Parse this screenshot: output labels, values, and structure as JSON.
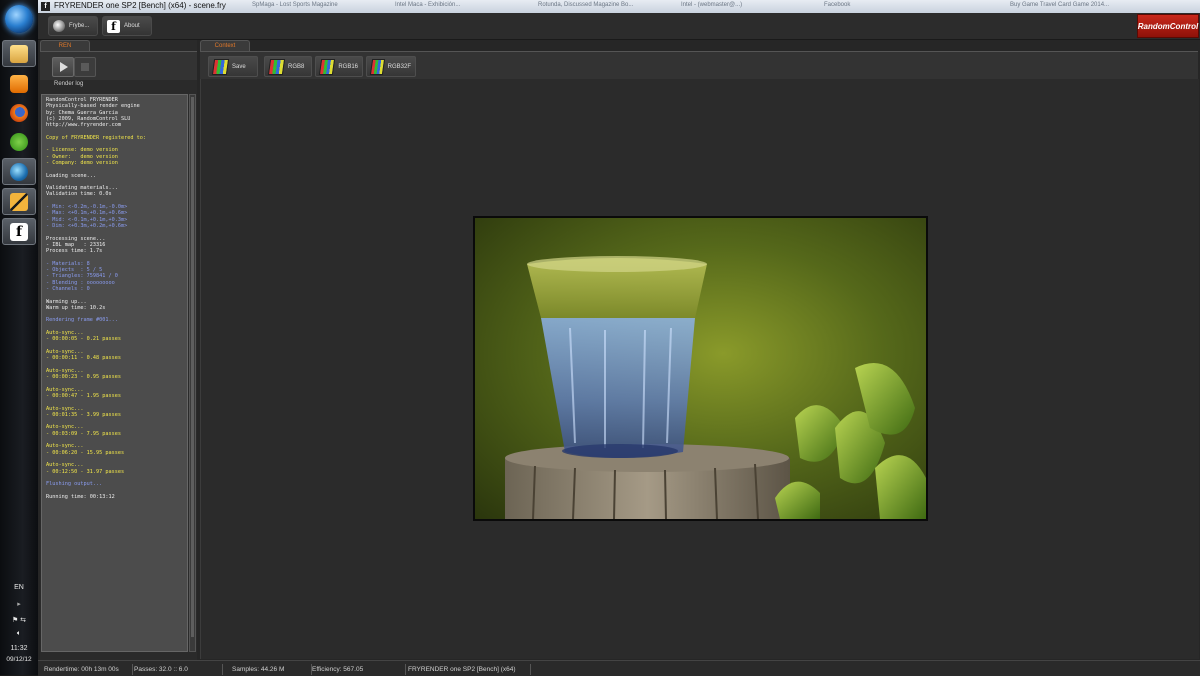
{
  "taskbar": {
    "language": "EN",
    "time": "11:32",
    "date": "09/12/12"
  },
  "window": {
    "title": "FRYRENDER one SP2 [Bench] (x64) - scene.fry",
    "background_tabs": [
      "SpMaga - Lost Sports Magazine",
      "Intel Maca - Exhibición...",
      "Rotunda, Discussed Magazine Bo...",
      "Intel - (webmaster@...)",
      "Facebook",
      "Buy Game Travel Card Game 2014..."
    ]
  },
  "toolbar": {
    "fry_label": "Frybe...",
    "about_label": "About",
    "brand": "RandomControl"
  },
  "ren_panel": {
    "tab": "REN",
    "log_label": "Render log",
    "log": [
      {
        "t": "RandomControl FRYRENDER",
        "c": "white"
      },
      {
        "t": "Physically-based render engine",
        "c": "white"
      },
      {
        "t": "by: Chema Guerra Garcia",
        "c": "white"
      },
      {
        "t": "(c) 2009, RandomControl SLU",
        "c": "white"
      },
      {
        "t": "http://www.fryrender.com",
        "c": "white"
      },
      {
        "t": "",
        "c": "white"
      },
      {
        "t": "Copy of FRYRENDER registered to:",
        "c": "yellow"
      },
      {
        "t": "",
        "c": "white"
      },
      {
        "t": "- License: demo version",
        "c": "yellow"
      },
      {
        "t": "- Owner:   demo version",
        "c": "yellow"
      },
      {
        "t": "- Company: demo version",
        "c": "yellow"
      },
      {
        "t": "",
        "c": "white"
      },
      {
        "t": "Loading scene...",
        "c": "white"
      },
      {
        "t": "",
        "c": "white"
      },
      {
        "t": "Validating materials...",
        "c": "white"
      },
      {
        "t": "Validation time: 0.0s",
        "c": "white"
      },
      {
        "t": "",
        "c": "white"
      },
      {
        "t": "- Min: <-0.2m,-0.1m,-0.0m>",
        "c": "blue"
      },
      {
        "t": "- Max: <+0.1m,+0.1m,+0.6m>",
        "c": "blue"
      },
      {
        "t": "- Mid: <-0.1m,+0.1m,+0.3m>",
        "c": "blue"
      },
      {
        "t": "- Dim: <+0.3m,+0.2m,+0.6m>",
        "c": "blue"
      },
      {
        "t": "",
        "c": "white"
      },
      {
        "t": "Processing scene...",
        "c": "white"
      },
      {
        "t": "- IBL map   : 23316",
        "c": "white"
      },
      {
        "t": "Process time: 1.7s",
        "c": "white"
      },
      {
        "t": "",
        "c": "white"
      },
      {
        "t": "- Materials: 8",
        "c": "blue"
      },
      {
        "t": "- Objects  : 5 / 5",
        "c": "blue"
      },
      {
        "t": "- Triangles: 759841 / 0",
        "c": "blue"
      },
      {
        "t": "- Blending : ooooooooo",
        "c": "blue"
      },
      {
        "t": "- Channels : 0",
        "c": "blue"
      },
      {
        "t": "",
        "c": "white"
      },
      {
        "t": "Warming up...",
        "c": "white"
      },
      {
        "t": "Warm up time: 10.2s",
        "c": "white"
      },
      {
        "t": "",
        "c": "white"
      },
      {
        "t": "Rendering frame #001...",
        "c": "blue"
      },
      {
        "t": "",
        "c": "white"
      },
      {
        "t": "Auto-sync...",
        "c": "yellow"
      },
      {
        "t": "- 00:00:05 - 0.21 passes",
        "c": "yellow"
      },
      {
        "t": "",
        "c": "white"
      },
      {
        "t": "Auto-sync...",
        "c": "yellow"
      },
      {
        "t": "- 00:00:11 - 0.48 passes",
        "c": "yellow"
      },
      {
        "t": "",
        "c": "white"
      },
      {
        "t": "Auto-sync...",
        "c": "yellow"
      },
      {
        "t": "- 00:00:23 - 0.95 passes",
        "c": "yellow"
      },
      {
        "t": "",
        "c": "white"
      },
      {
        "t": "Auto-sync...",
        "c": "yellow"
      },
      {
        "t": "- 00:00:47 - 1.95 passes",
        "c": "yellow"
      },
      {
        "t": "",
        "c": "white"
      },
      {
        "t": "Auto-sync...",
        "c": "yellow"
      },
      {
        "t": "- 00:01:35 - 3.99 passes",
        "c": "yellow"
      },
      {
        "t": "",
        "c": "white"
      },
      {
        "t": "Auto-sync...",
        "c": "yellow"
      },
      {
        "t": "- 00:03:09 - 7.95 passes",
        "c": "yellow"
      },
      {
        "t": "",
        "c": "white"
      },
      {
        "t": "Auto-sync...",
        "c": "yellow"
      },
      {
        "t": "- 00:06:20 - 15.95 passes",
        "c": "yellow"
      },
      {
        "t": "",
        "c": "white"
      },
      {
        "t": "Auto-sync...",
        "c": "yellow"
      },
      {
        "t": "- 00:12:50 - 31.97 passes",
        "c": "yellow"
      },
      {
        "t": "",
        "c": "white"
      },
      {
        "t": "Flushing output...",
        "c": "blue"
      },
      {
        "t": "",
        "c": "white"
      },
      {
        "t": "Running time: 00:13:12",
        "c": "white"
      }
    ]
  },
  "context_panel": {
    "tab": "Context",
    "buttons": [
      "Save",
      "RGB8",
      "RGB16",
      "RGB32F"
    ]
  },
  "status_bar": {
    "rendertime": "Rendertime:  00h 13m 00s",
    "passes": "Passes:  32.0 :: 6.0",
    "samples": "Samples:  44.26 M",
    "efficiency": "Efficiency:  567.05",
    "product": "FRYRENDER one SP2 [Bench] (x64)"
  },
  "colors": {
    "brand": "#b01e12",
    "accent_tab": "#e0782a",
    "log_bg": "#4c4c4c"
  }
}
